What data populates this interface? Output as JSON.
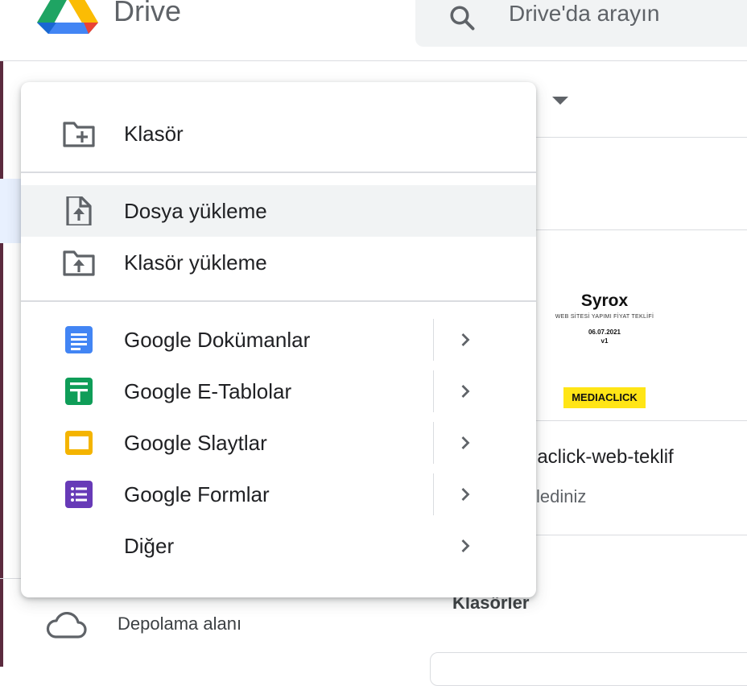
{
  "header": {
    "brand": "Drive",
    "search_placeholder": "Drive'da arayın"
  },
  "background": {
    "file": {
      "preview_title": "Syrox",
      "preview_subtitle": "WEB SİTESİ YAPIMI FİYAT TEKLİFİ",
      "preview_date": "06.07.2021",
      "preview_version": "v1",
      "preview_brand": "MEDIACLICK",
      "name": "iaclick-web-teklif",
      "meta": "lediniz"
    },
    "section_title": "Klasörler",
    "storage_label": "Depolama alanı"
  },
  "menu": {
    "folder": "Klasör",
    "upload_file": "Dosya yükleme",
    "upload_folder": "Klasör yükleme",
    "apps": [
      {
        "label": "Google Dokümanlar",
        "icon": "docs-icon",
        "color": "#4285f4"
      },
      {
        "label": "Google E-Tablolar",
        "icon": "sheets-icon",
        "color": "#0f9d58"
      },
      {
        "label": "Google Slaytlar",
        "icon": "slides-icon",
        "color": "#f4b400"
      },
      {
        "label": "Google Formlar",
        "icon": "forms-icon",
        "color": "#673ab7"
      }
    ],
    "more": "Diğer"
  }
}
